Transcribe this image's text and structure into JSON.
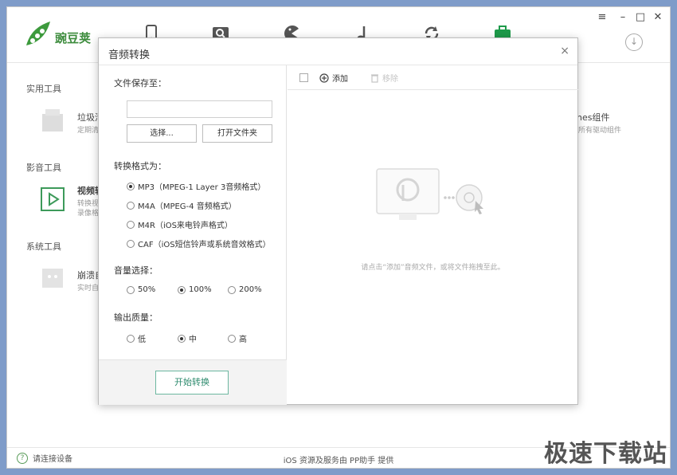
{
  "app": {
    "brand": "豌豆荚",
    "nav_icons": [
      "phone-icon",
      "search-icon",
      "game-icon",
      "music-icon",
      "sync-icon",
      "toolbox-icon"
    ],
    "window_controls": [
      "≡",
      "–",
      "□",
      "✕"
    ],
    "download_icon": "↓"
  },
  "background": {
    "sections": [
      {
        "title": "实用工具",
        "tool_name": "垃圾清",
        "tool_desc": "定期清"
      },
      {
        "title": "影音工具",
        "tool_name": "视频转",
        "tool_desc": "转换视",
        "tool_desc2": "录像格"
      },
      {
        "title": "系统工具",
        "tool_name": "崩溃自",
        "tool_desc": "实时自"
      }
    ],
    "right_tool_name": "unes组件",
    "right_tool_desc": "更所有驱动组件"
  },
  "status": {
    "help_icon": "?",
    "left_text": "请连接设备",
    "center_text": "iOS 资源及服务由 PP助手 提供"
  },
  "watermark": "极速下载站",
  "dialog": {
    "title": "音频转换",
    "close": "×",
    "save_to_label": "文件保存至：",
    "path_value": "",
    "choose_button": "选择...",
    "open_folder_button": "打开文件夹",
    "format_label": "转换格式为：",
    "formats": [
      {
        "label": "MP3（MPEG-1 Layer 3音频格式）",
        "selected": true
      },
      {
        "label": "M4A（MPEG-4 音频格式）",
        "selected": false
      },
      {
        "label": "M4R（iOS来电铃声格式）",
        "selected": false
      },
      {
        "label": "CAF（iOS短信铃声或系统音效格式）",
        "selected": false
      }
    ],
    "volume_label": "音量选择：",
    "volumes": [
      {
        "label": "50%",
        "selected": false
      },
      {
        "label": "100%",
        "selected": true
      },
      {
        "label": "200%",
        "selected": false
      }
    ],
    "quality_label": "输出质量：",
    "qualities": [
      {
        "label": "低",
        "selected": false
      },
      {
        "label": "中",
        "selected": true
      },
      {
        "label": "高",
        "selected": false
      }
    ],
    "start_button": "开始转换",
    "toolbar": {
      "add_label": "添加",
      "remove_label": "移除"
    },
    "empty_hint": "请点击“添加”音频文件，或将文件拖拽至此。"
  },
  "colors": {
    "accent_green": "#2e8b6e",
    "brand_green": "#3d8c3d"
  }
}
